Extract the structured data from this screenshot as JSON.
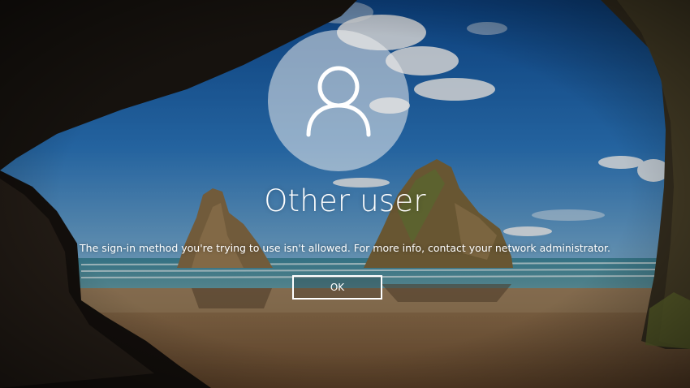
{
  "lock_screen": {
    "user_name": "Other user",
    "message": "The sign-in method you're trying to use isn't allowed. For more info, contact your network administrator.",
    "ok_label": "OK",
    "avatar_icon": "user-silhouette-icon"
  },
  "colors": {
    "text": "#ffffff",
    "sky": "#1e5fa8",
    "sea": "#2f6f8a",
    "sand": "#8b6a45",
    "cave": "#1a1410"
  }
}
